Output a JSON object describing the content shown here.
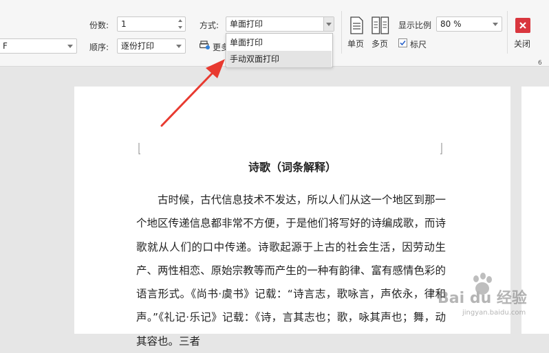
{
  "toolbar": {
    "left_select_value": "F",
    "copies_label": "份数:",
    "copies_value": "1",
    "order_label": "顺序:",
    "order_value": "逐份打印",
    "mode_label": "方式:",
    "mode_value": "单面打印",
    "more_label": "更多",
    "single_page_label": "单页",
    "multi_page_label": "多页",
    "zoom_label": "显示比例",
    "zoom_value": "80 %",
    "ruler_label": "标尺",
    "ruler_checked": true,
    "close_label": "关闭",
    "close_color": "#d9363e",
    "ruler_number": "6"
  },
  "dropdown": {
    "items": [
      "单面打印",
      "手动双面打印"
    ],
    "highlighted_index": 1
  },
  "annotation": {
    "arrow_color": "#e83a30"
  },
  "document": {
    "title": "诗歌（词条解释）",
    "paragraph": "古时候，古代信息技术不发达，所以人们从这一个地区到那一个地区传递信息都非常不方便，于是他们将写好的诗编成歌，而诗歌就从人们的口中传递。诗歌起源于上古的社会生活，因劳动生产、两性相恋、原始宗教等而产生的一种有韵律、富有感情色彩的语言形式。《尚书·虞书》记载：“诗言志，歌咏言，声依永，律和声。”《礼记·乐记》记载：《诗，言其志也；歌，咏其声也；舞，动其容也。三者"
  },
  "watermark": {
    "text_main": "Bai du 经验",
    "text_sub": "jingyan.baidu.com"
  }
}
